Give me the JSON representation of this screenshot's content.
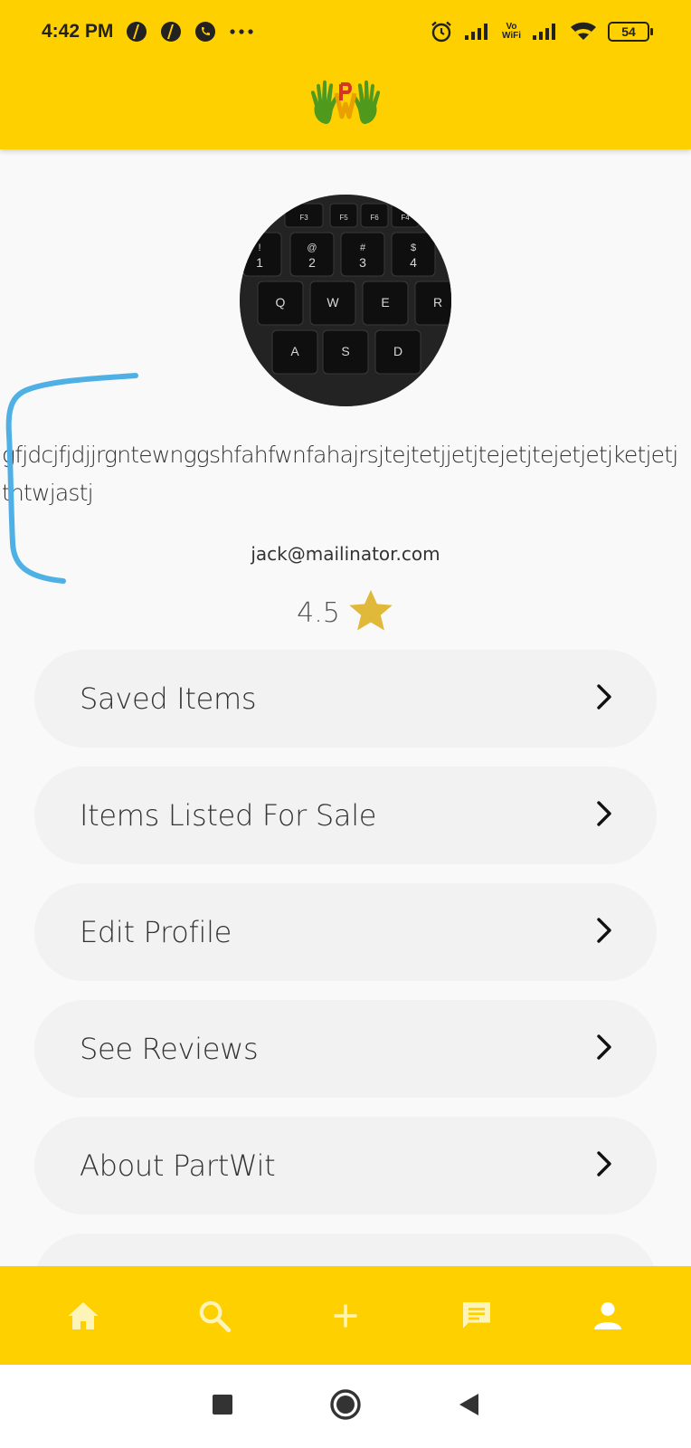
{
  "status_bar": {
    "time": "4:42 PM",
    "battery": "54",
    "volte_top": "Vo",
    "volte_bottom": "WiFi",
    "icons": [
      "hike-icon",
      "hike-icon",
      "call-icon",
      "more-dots-icon",
      "alarm-icon",
      "signal-icon",
      "wifi-icon",
      "battery-icon"
    ]
  },
  "app_bar": {
    "logo_icon": "partwit-logo-icon"
  },
  "profile": {
    "bio": "gfjdcjfjdjjrgntewnggshfahfwnfahajrsjtejtetjjetjtejetjtejetjetjketjetjtntwjastj",
    "email": "jack@mailinator.com",
    "rating": "4.5",
    "rating_icon": "star-icon",
    "avatar_icon": "keyboard-photo"
  },
  "menu": {
    "items": [
      {
        "label": "Saved Items"
      },
      {
        "label": "Items Listed For Sale"
      },
      {
        "label": "Edit Profile"
      },
      {
        "label": "See Reviews"
      },
      {
        "label": "About PartWit"
      }
    ]
  },
  "bottom_nav": {
    "items": [
      "home-icon",
      "search-icon",
      "add-icon",
      "chat-icon",
      "profile-icon"
    ]
  },
  "system_nav": {
    "items": [
      "recents-icon",
      "home-circle-icon",
      "back-icon"
    ]
  },
  "colors": {
    "accent": "#ffd000",
    "star": "#e0b83a",
    "scribble": "#4fb0e6",
    "card": "#f2f2f2",
    "background": "#f9f9f9"
  }
}
